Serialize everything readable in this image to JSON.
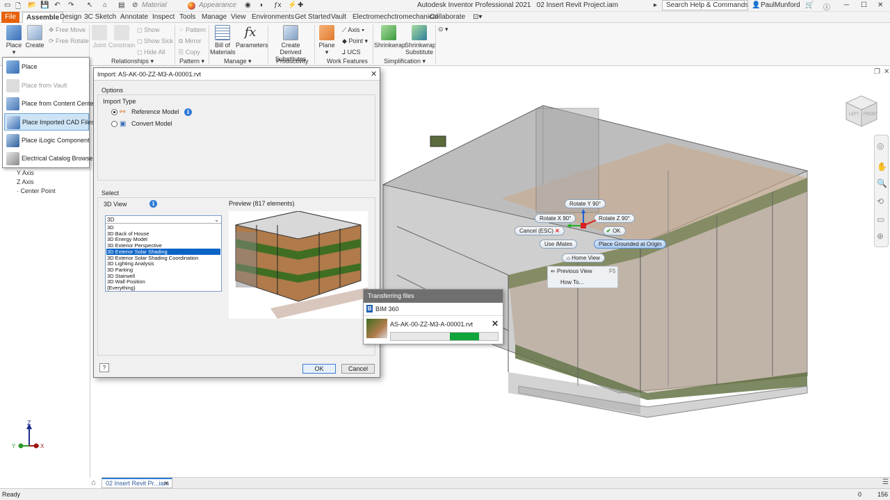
{
  "app": {
    "title": "Autodesk Inventor Professional 2021",
    "document": "02 Insert Revit Project.iam",
    "material_combo": "Material",
    "appearance_combo": "Appearance",
    "search_placeholder": "Search Help & Commands...",
    "user": "PaulMunford"
  },
  "tabs": [
    "File",
    "Assemble",
    "Design",
    "Sketch",
    "Annotate",
    "Inspect",
    "Tools",
    "Manage",
    "View",
    "Environments",
    "Get Started",
    "Vault",
    "Electromechctromechanical",
    "Collaborate"
  ],
  "active_tab": "Assemble",
  "ribbon": {
    "place": "Place",
    "create": "Create",
    "joint": "Joint",
    "constrain": "Constrain",
    "free_move": "Free Move",
    "free_rotate": "Free Rotate",
    "show": "Show",
    "show_sick": "Show Sick",
    "hide_all": "Hide All",
    "pattern": "Pattern",
    "mirror": "Mirror",
    "copy": "Copy",
    "bill_of_materials": "Bill of Materials",
    "parameters": "Parameters",
    "create_derived": "Create Derived Substitutes",
    "plane": "Plane",
    "axis": "Axis",
    "point": "Point",
    "ucs": "UCS",
    "shrinkwrap": "Shrinkwrap",
    "shrinkwrap_substitute": "Shrinkwrap Substitute",
    "panels": {
      "relationships": "Relationships",
      "pattern": "Pattern",
      "manage": "Manage",
      "productivity": "Productivity",
      "work_features": "Work Features",
      "simplification": "Simplification"
    }
  },
  "place_menu": {
    "items": [
      {
        "label": "Place"
      },
      {
        "label": "Place from Vault"
      },
      {
        "label": "Place from Content Center"
      },
      {
        "label": "Place Imported CAD Files"
      },
      {
        "label": "Place iLogic Component"
      },
      {
        "label": "Electrical  Catalog Browser"
      }
    ],
    "highlighted_index": 3
  },
  "browser": {
    "items": [
      "Y Axis",
      "Z Axis",
      "Center Point"
    ]
  },
  "dialog": {
    "title": "Import:  AS-AK-00-ZZ-M3-A-00001.rvt",
    "options_label": "Options",
    "import_type_label": "Import Type",
    "reference_model": "Reference Model",
    "convert_model": "Convert Model",
    "select_label": "Select",
    "view_label": "3D View",
    "preview_label": "Preview (817 elements)",
    "view_selected": "3D",
    "view_options": [
      "3D",
      "3D Back of House",
      "3D Energy Model",
      "3D Exterior Perspective",
      "3D Exterior Solar Shading",
      "3D Exterior Solar Shading Coordination",
      "3D Lighting Analysis",
      "3D Parking",
      "3D Stairwell",
      "3D Wall Position",
      "{Everything}"
    ],
    "view_highlighted_index": 4,
    "ok": "OK",
    "cancel": "Cancel"
  },
  "transfer": {
    "header": "Transferring files",
    "service": "BIM 360",
    "file": "AS-AK-00-ZZ-M3-A-00001.rvt",
    "progress": 0.42
  },
  "context_tools": {
    "rotate_y": "Rotate Y 90°",
    "rotate_x": "Rotate X 90°",
    "rotate_z": "Rotate Z 90°",
    "cancel": "Cancel (ESC)",
    "ok": "OK",
    "use_imates": "Use iMates",
    "place_grounded": "Place Grounded at Origin",
    "home_view": "Home View",
    "previous_view": "Previous View",
    "previous_view_key": "F5",
    "how_to": "How To..."
  },
  "doc_tab": "02 Insert Revit Pr...iam",
  "status": {
    "left": "Ready",
    "count_a": "0",
    "count_b": "156"
  },
  "viewcube": {
    "left": "LEFT",
    "front": "FRONT"
  },
  "triad": {
    "z": "Z",
    "y": "Y",
    "x": "X"
  }
}
